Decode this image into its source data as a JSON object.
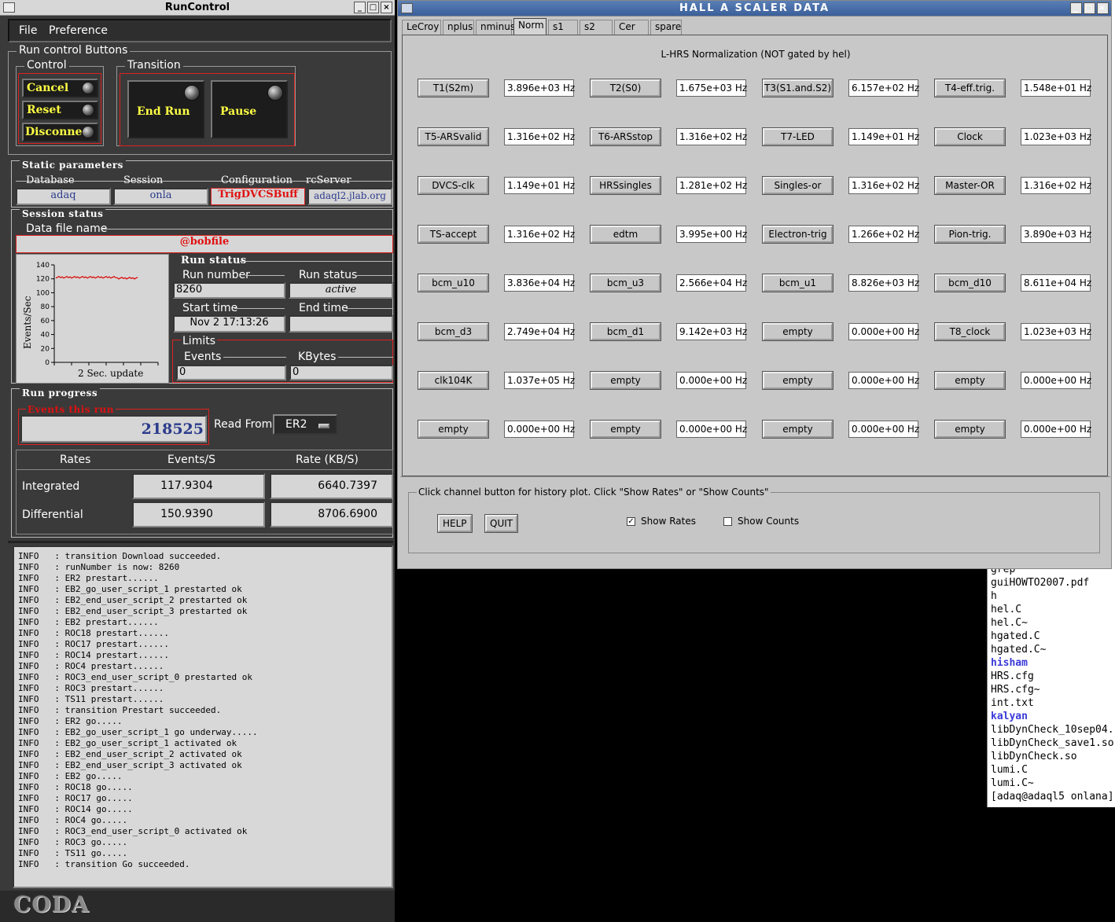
{
  "runcontrol": {
    "title": "RunControl",
    "menu": [
      "File",
      "Preference"
    ],
    "run_control_buttons_label": "Run control Buttons",
    "control_label": "Control",
    "control_buttons": [
      "Cancel",
      "Reset",
      "Disconnect"
    ],
    "transition_label": "Transition",
    "transition_buttons": [
      "End Run",
      "Pause"
    ],
    "static_parameters_label": "Static parameters",
    "static_parameters": [
      {
        "label": "Database",
        "value": "adaq"
      },
      {
        "label": "Session",
        "value": "onla"
      },
      {
        "label": "Configuration",
        "value": "TrigDVCSBuff"
      },
      {
        "label": "rcServer",
        "value": "adaql2.jlab.org"
      }
    ],
    "session_status_label": "Session status",
    "data_file_label": "Data file name",
    "data_file_value": "@bobfile",
    "plot": {
      "ylabel": "Events/Sec",
      "xlabel": "2 Sec. update",
      "yticks": [
        "140",
        "120",
        "100",
        "80",
        "60",
        "40",
        "20",
        "0"
      ]
    },
    "run_status_label": "Run status",
    "run_number_label": "Run number",
    "run_number_value": "8260",
    "run_status_field_label": "Run status",
    "run_status_value": "active",
    "start_time_label": "Start time",
    "start_time_value": "Nov 2 17:13:26",
    "end_time_label": "End time",
    "end_time_value": "",
    "limits_label": "Limits",
    "events_label": "Events",
    "events_value": "0",
    "kbytes_label": "KBytes",
    "kbytes_value": "0",
    "run_progress_label": "Run progress",
    "events_this_run_label": "Events this run",
    "events_this_run_value": "218525",
    "read_from_label": "Read From:",
    "read_from_value": "ER2",
    "rates": {
      "header": [
        "Rates",
        "Events/S",
        "Rate (KB/S)"
      ],
      "integrated_label": "Integrated",
      "integrated_events": "117.9304",
      "integrated_rate": "6640.7397",
      "differential_label": "Differential",
      "differential_events": "150.9390",
      "differential_rate": "8706.6900"
    },
    "log": [
      "INFO   : transition Download succeeded.",
      "INFO   : runNumber is now: 8260",
      "INFO   : ER2 prestart......",
      "INFO   : EB2_go_user_script_1 prestarted ok",
      "INFO   : EB2_end_user_script_2 prestarted ok",
      "INFO   : EB2_end_user_script_3 prestarted ok",
      "INFO   : EB2 prestart......",
      "INFO   : ROC18 prestart......",
      "INFO   : ROC17 prestart......",
      "INFO   : ROC14 prestart......",
      "INFO   : ROC4 prestart......",
      "INFO   : ROC3_end_user_script_0 prestarted ok",
      "INFO   : ROC3 prestart......",
      "INFO   : TS11 prestart......",
      "INFO   : transition Prestart succeeded.",
      "INFO   : ER2 go.....",
      "INFO   : EB2_go_user_script_1 go underway.....",
      "INFO   : EB2_go_user_script_1 activated ok",
      "INFO   : EB2_end_user_script_2 activated ok",
      "INFO   : EB2_end_user_script_3 activated ok",
      "INFO   : EB2 go.....",
      "INFO   : ROC18 go.....",
      "INFO   : ROC17 go.....",
      "INFO   : ROC14 go.....",
      "INFO   : ROC4 go.....",
      "INFO   : ROC3_end_user_script_0 activated ok",
      "INFO   : ROC3 go.....",
      "INFO   : TS11 go.....",
      "INFO   : transition Go succeeded."
    ],
    "logo": "CODA"
  },
  "scaler": {
    "title": "HALL  A  SCALER  DATA",
    "tabs": [
      "LeCroy",
      "nplus",
      "nminus",
      "Norm",
      "s1",
      "s2",
      "Cer",
      "spare"
    ],
    "selected_tab": "Norm",
    "panel_title": "L-HRS Normalization (NOT gated by hel)",
    "rows": [
      [
        [
          "T1(S2m)",
          "3.896e+03 Hz"
        ],
        [
          "T2(S0)",
          "1.675e+03 Hz"
        ],
        [
          "T3(S1.and.S2)",
          "6.157e+02 Hz"
        ],
        [
          "T4-eff.trig.",
          "1.548e+01 Hz"
        ]
      ],
      [
        [
          "T5-ARSvalid",
          "1.316e+02 Hz"
        ],
        [
          "T6-ARSstop",
          "1.316e+02 Hz"
        ],
        [
          "T7-LED",
          "1.149e+01 Hz"
        ],
        [
          "Clock",
          "1.023e+03 Hz"
        ]
      ],
      [
        [
          "DVCS-clk",
          "1.149e+01 Hz"
        ],
        [
          "HRSsingles",
          "1.281e+02 Hz"
        ],
        [
          "Singles-or",
          "1.316e+02 Hz"
        ],
        [
          "Master-OR",
          "1.316e+02 Hz"
        ]
      ],
      [
        [
          "TS-accept",
          "1.316e+02 Hz"
        ],
        [
          "edtm",
          "3.995e+00 Hz"
        ],
        [
          "Electron-trig",
          "1.266e+02 Hz"
        ],
        [
          "Pion-trig.",
          "3.890e+03 Hz"
        ]
      ],
      [
        [
          "bcm_u10",
          "3.836e+04 Hz"
        ],
        [
          "bcm_u3",
          "2.566e+04 Hz"
        ],
        [
          "bcm_u1",
          "8.826e+03 Hz"
        ],
        [
          "bcm_d10",
          "8.611e+04 Hz"
        ]
      ],
      [
        [
          "bcm_d3",
          "2.749e+04 Hz"
        ],
        [
          "bcm_d1",
          "9.142e+03 Hz"
        ],
        [
          "empty",
          "0.000e+00 Hz"
        ],
        [
          "T8_clock",
          "1.023e+03 Hz"
        ]
      ],
      [
        [
          "clk104K",
          "1.037e+05 Hz"
        ],
        [
          "empty",
          "0.000e+00 Hz"
        ],
        [
          "empty",
          "0.000e+00 Hz"
        ],
        [
          "empty",
          "0.000e+00 Hz"
        ]
      ],
      [
        [
          "empty",
          "0.000e+00 Hz"
        ],
        [
          "empty",
          "0.000e+00 Hz"
        ],
        [
          "empty",
          "0.000e+00 Hz"
        ],
        [
          "empty",
          "0.000e+00 Hz"
        ]
      ]
    ],
    "hint": "Click channel button for history plot.  Click \"Show Rates\" or \"Show Counts\"",
    "help_label": "HELP",
    "quit_label": "QUIT",
    "show_rates_label": "Show Rates",
    "show_counts_label": "Show Counts"
  },
  "terminal": {
    "lines": [
      "grep",
      "guiHOWTO2007.pdf",
      "h",
      "hel.C",
      "hel.C~",
      "hgated.C",
      "hgated.C~",
      "hisham",
      "HRS.cfg",
      "HRS.cfg~",
      "int.txt",
      "kalyan",
      "libDynCheck_10sep04.",
      "libDynCheck_save1.so",
      "libDynCheck.so",
      "lumi.C",
      "lumi.C~",
      "[adaq@adaql5 onlana]"
    ],
    "dirs": [
      "hisham",
      "kalyan"
    ]
  }
}
